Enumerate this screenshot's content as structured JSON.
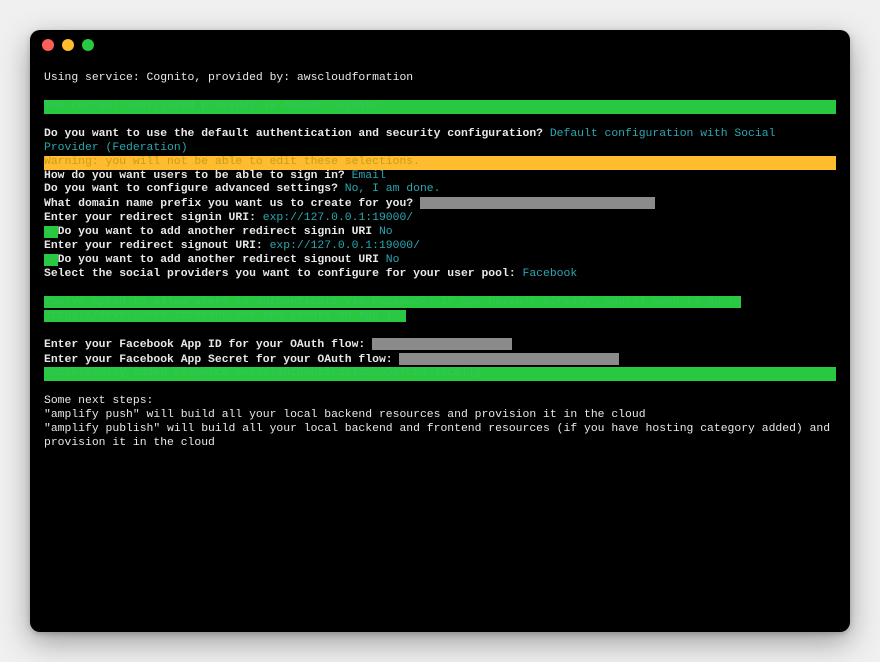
{
  "titlebar": {
    "close": "close",
    "min": "minimize",
    "max": "maximize"
  },
  "intro": {
    "service_line": "Using service: Cognito, provided by: awscloudformation",
    "provider_line": " The current configured provider is Amazon Cognito. "
  },
  "q": {
    "default_auth_prompt": " Do you want to use the default authentication and security configuration? ",
    "default_auth_answer": "Default configuration with Social Provider (Federation)",
    "warning": " Warning: you will not be able to edit these selections. ",
    "signin_prompt": " How do you want users to be able to sign in? ",
    "signin_answer": "Email",
    "advanced_prompt": " Do you want to configure advanced settings? ",
    "advanced_answer": "No, I am done.",
    "domain_prefix_prompt": " What domain name prefix you want us to create for you? ",
    "signin_uri_prompt": " Enter your redirect signin URI: ",
    "signin_uri_answer": "exp://127.0.0.1:19000/",
    "add_signin_q_mark": "? ",
    "add_signin_prompt": "Do you want to add another redirect signin URI ",
    "add_signin_answer": "No",
    "signout_uri_prompt": " Enter your redirect signout URI: ",
    "signout_uri_answer": "exp://127.0.0.1:19000/",
    "add_signout_q_mark": "? ",
    "add_signout_prompt": "Do you want to add another redirect signout URI ",
    "add_signout_answer": "No",
    "select_providers_prompt": " Select the social providers you want to configure for your user pool: ",
    "select_providers_answer": "Facebook",
    "opt_line": " You've opted to allow users to authenticate via Facebook.  If you haven't already, you'll need to go to https://developers.facebook.com and create an App ID. ",
    "fb_id_prompt": " Enter your Facebook App ID for your OAuth flow:  ",
    "fb_secret_prompt": " Enter your Facebook App Secret for your OAuth flow:  ",
    "success": "Successfully added resource socialauthentication2552fcb3 locally"
  },
  "next": {
    "header": "Some next steps:",
    "push": "\"amplify push\" will build all your local backend resources and provision it in the cloud",
    "publish": "\"amplify publish\" will build all your local backend and frontend resources (if you have hosting category added) and provision it in the cloud"
  }
}
